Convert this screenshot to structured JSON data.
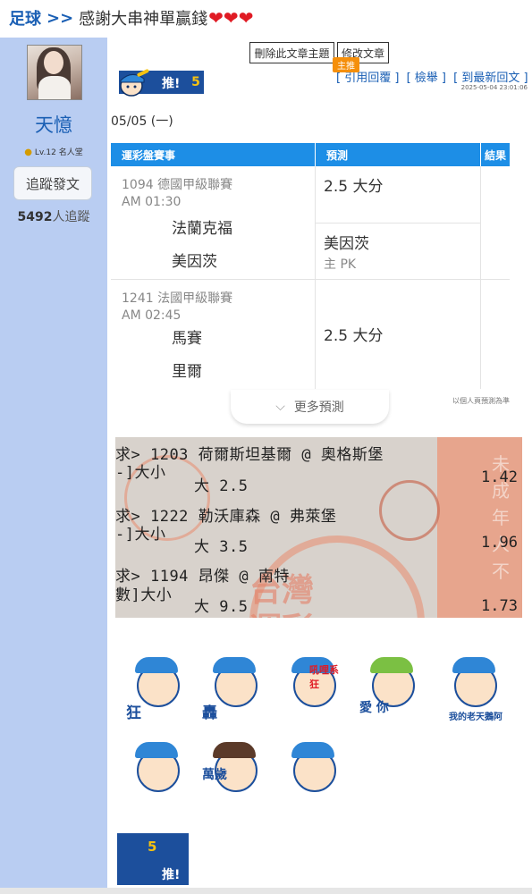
{
  "header": {
    "category": "足球",
    "separator": ">>",
    "title": "感謝大串神單贏錢",
    "hearts": "❤❤❤"
  },
  "sidebar": {
    "username": "天憶",
    "level": "Lv.12 名人堂",
    "follow_button": "追蹤發文",
    "followers_count": "5492",
    "followers_label": "人追蹤"
  },
  "toolbar": {
    "delete_label": "刪除此文章主題",
    "edit_label": "修改文章",
    "quote_link": "[ 引用回覆 ]",
    "report_link": "[ 檢舉 ]",
    "latest_link": "[ 到最新回文 ]",
    "datetime": "2025-05-04 23:01:06"
  },
  "push": {
    "label": "推!",
    "count": "5"
  },
  "post": {
    "date": "05/05 (一)",
    "table": {
      "headers": [
        "運彩盤賽事",
        "預測",
        "結果"
      ],
      "games": [
        {
          "league": "1094 德國甲級聯賽",
          "time": "AM 01:30",
          "home": "法蘭克福",
          "away": "美因茨",
          "predictions": [
            {
              "main": "2.5 大分",
              "tag": "主推"
            },
            {
              "main": "美因茨",
              "sub": "主 PK"
            }
          ]
        },
        {
          "league": "1241 法國甲級聯賽",
          "time": "AM 02:45",
          "home": "馬賽",
          "away": "里爾",
          "predictions": [
            {
              "main": "2.5 大分"
            }
          ]
        }
      ]
    },
    "more_label": "更多預測",
    "disclaimer": "以個人頁預測為準"
  },
  "ticket": {
    "lines": [
      {
        "code": "求> 1203",
        "match": "荷爾斯坦基爾 @ 奧格斯堡",
        "type": "-]大小",
        "pick": "大 2.5",
        "odds": "1.42"
      },
      {
        "code": "求> 1222",
        "match": "勒沃庫森 @ 弗萊堡",
        "type": "-]大小",
        "pick": "大 3.5",
        "odds": "1.96"
      },
      {
        "code": "求> 1194",
        "match": "昂傑 @ 南特",
        "type": "數]大小",
        "pick": "大 9.5",
        "odds": "1.73"
      }
    ],
    "watermark": "台灣",
    "watermark2": "運彩",
    "vertical_text": "未成年人不"
  },
  "stickers": [
    {
      "label": "狂"
    },
    {
      "label": "轟"
    },
    {
      "label": "吼哩系 狂"
    },
    {
      "label": "愛 你"
    },
    {
      "label": "我的老天鵝阿"
    },
    {
      "label": ""
    },
    {
      "label": "萬歲"
    },
    {
      "label": ""
    }
  ],
  "bottom_push": {
    "count": "5",
    "label": "推!"
  }
}
